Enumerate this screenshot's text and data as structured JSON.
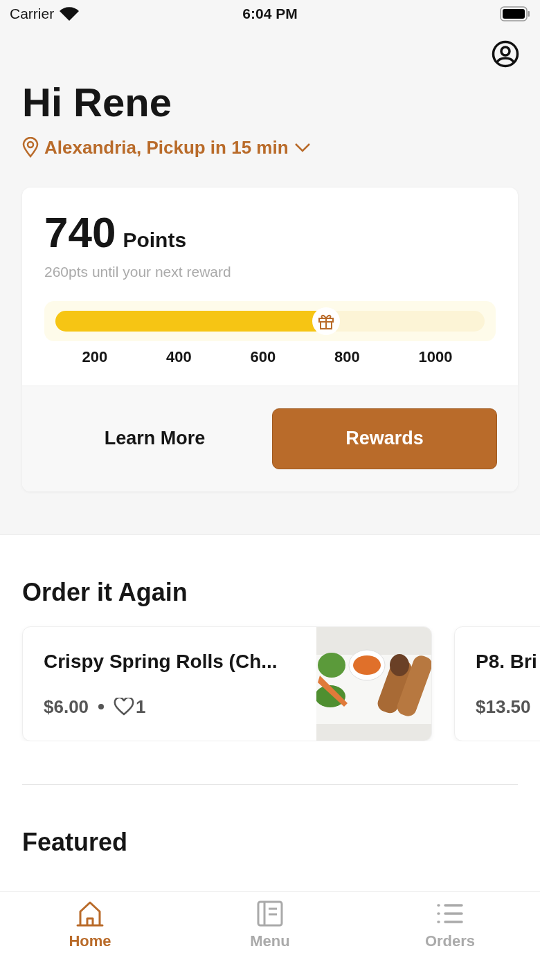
{
  "status_bar": {
    "carrier": "Carrier",
    "time": "6:04 PM"
  },
  "greeting": "Hi Rene",
  "location": "Alexandria, Pickup in 15 min",
  "rewards_card": {
    "points": "740",
    "points_label": "Points",
    "subtitle": "260pts until your next reward",
    "level": 0.63,
    "ticks": [
      "200",
      "400",
      "600",
      "800",
      "1000"
    ],
    "buttons": [
      {
        "label": "Learn More",
        "kind": "plain"
      },
      {
        "label": "Rewards",
        "kind": "primary"
      }
    ]
  },
  "order_again": {
    "title": "Order it Again",
    "items": [
      {
        "name": "Crispy Spring Rolls (Ch...",
        "price": "$6.00",
        "likes": "1",
        "kind": "full"
      },
      {
        "name": "P8. Bri",
        "price": "$13.50",
        "kind": "cut"
      }
    ]
  },
  "featured": {
    "title": "Featured"
  },
  "tabs": [
    {
      "label": "Home",
      "kind": "home",
      "selected": true
    },
    {
      "label": "Menu",
      "kind": "menu",
      "selected": false
    },
    {
      "label": "Orders",
      "kind": "orders",
      "selected": false
    }
  ]
}
